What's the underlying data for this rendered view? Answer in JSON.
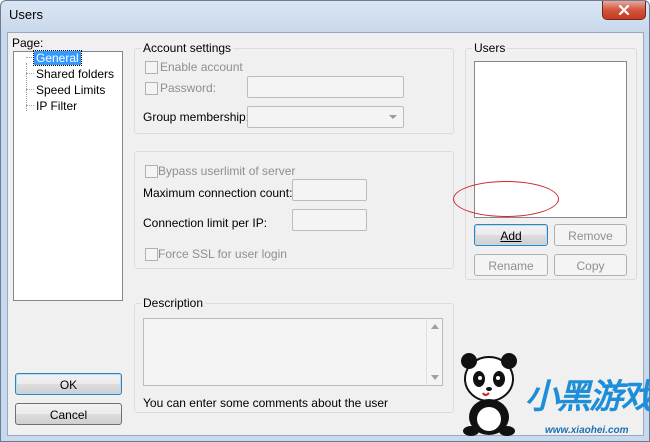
{
  "window": {
    "title": "Users"
  },
  "page_panel": {
    "label": "Page:",
    "items": [
      "General",
      "Shared folders",
      "Speed Limits",
      "IP Filter"
    ],
    "selected": "General"
  },
  "account_settings": {
    "title": "Account settings",
    "enable_account": "Enable account",
    "password": "Password:",
    "group_membership": "Group membership:"
  },
  "limits": {
    "bypass": "Bypass userlimit of server",
    "max_connections": "Maximum connection count:",
    "conn_limit_per_ip": "Connection limit per IP:",
    "force_ssl": "Force SSL for user login"
  },
  "description": {
    "title": "Description",
    "hint": "You can enter some comments about the user"
  },
  "users": {
    "title": "Users",
    "add": "Add",
    "remove": "Remove",
    "rename": "Rename",
    "copy": "Copy"
  },
  "buttons": {
    "ok": "OK",
    "cancel": "Cancel"
  },
  "watermark": {
    "brand": "小黑游戏",
    "url": "www.xiaohei.com"
  },
  "colors": {
    "selection": "#3399ff",
    "highlight_ring": "#d0282a",
    "close_button": "#c7391f"
  }
}
